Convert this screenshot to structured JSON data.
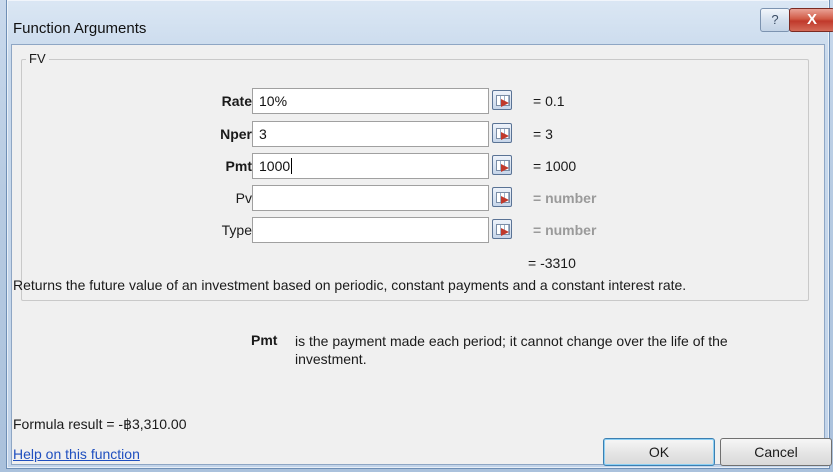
{
  "window": {
    "title": "Function Arguments",
    "help_button": "?",
    "close_button": "X"
  },
  "function": {
    "name": "FV",
    "args": [
      {
        "label": "Rate",
        "value": "10%",
        "evaluated": "= 0.1",
        "bold": true
      },
      {
        "label": "Nper",
        "value": "3",
        "evaluated": "= 3",
        "bold": true
      },
      {
        "label": "Pmt",
        "value": "1000",
        "evaluated": "= 1000",
        "bold": true
      },
      {
        "label": "Pv",
        "value": "",
        "evaluated": "= number",
        "bold": false
      },
      {
        "label": "Type",
        "value": "",
        "evaluated": "= number",
        "bold": false
      }
    ],
    "result": "= -3310",
    "description": "Returns the future value of an investment based on periodic, constant payments and a constant interest rate.",
    "arg_help_name": "Pmt",
    "arg_help_text": "is the payment made each period; it cannot change over the life of the investment."
  },
  "footer": {
    "formula_result": "Formula result =  -฿3,310.00",
    "help_link": "Help on this function",
    "ok_label": "OK",
    "cancel_label": "Cancel"
  },
  "colors": {
    "link": "#1f4fbf",
    "close": "#c0392b"
  }
}
